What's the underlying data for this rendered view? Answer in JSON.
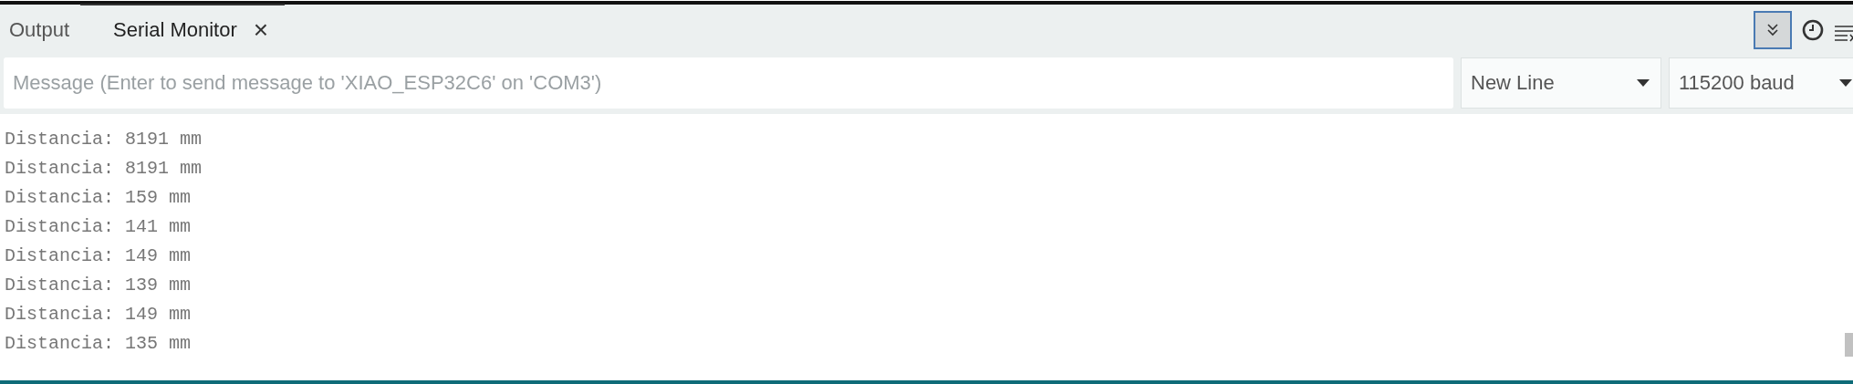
{
  "tabs": [
    {
      "label": "Output",
      "selected": false
    },
    {
      "label": "Serial Monitor",
      "selected": true,
      "close_glyph": "×"
    }
  ],
  "toolbar": {
    "autoscroll_on": true
  },
  "message": {
    "placeholder": "Message (Enter to send message to 'XIAO_ESP32C6' on 'COM3')"
  },
  "line_ending": {
    "value": "New Line"
  },
  "baud_rate": {
    "value": "115200 baud"
  },
  "output_lines": [
    "Distancia: 8191 mm",
    "Distancia: 8191 mm",
    "Distancia: 159 mm",
    "Distancia: 141 mm",
    "Distancia: 149 mm",
    "Distancia: 139 mm",
    "Distancia: 149 mm",
    "Distancia: 135 mm"
  ]
}
